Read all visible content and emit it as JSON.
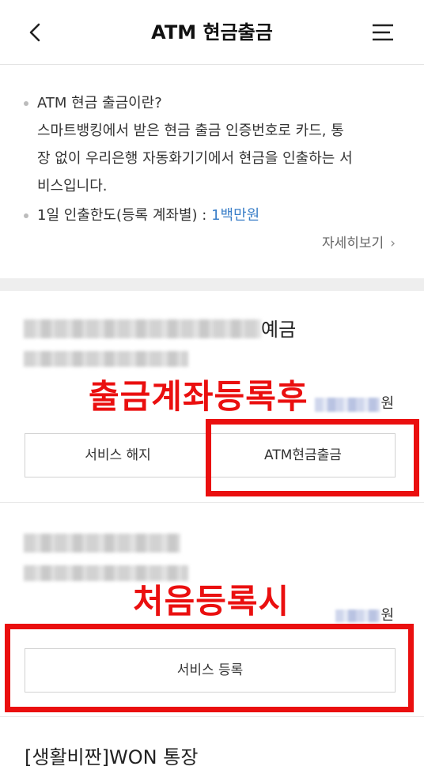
{
  "header": {
    "back_icon": "chevron-left-icon",
    "title": "ATM 현금출금",
    "menu_icon": "hamburger-menu-icon"
  },
  "info": {
    "line1": "ATM 현금 출금이란?",
    "line2": "스마트뱅킹에서 받은 현금 출금 인증번호로 카드, 통",
    "line3": "장 없이 우리은행 자동화기기에서 현금을 인출하는 서",
    "line4": "비스입니다.",
    "limit_label": "1일 인출한도(등록 계좌별) : ",
    "limit_value": "1백만원",
    "more_label": "자세히보기",
    "more_icon": "chevron-right-icon"
  },
  "accounts": [
    {
      "name_suffix": "예금",
      "won": "원",
      "buttons": {
        "cancel": "서비스 해지",
        "withdraw": "ATM현금출금"
      },
      "annotation": "출금계좌등록후"
    },
    {
      "won": "원",
      "buttons": {
        "register": "서비스 등록"
      },
      "annotation": "처음등록시"
    },
    {
      "name": "[생활비짠]WON 통장"
    }
  ],
  "colors": {
    "accent_blue": "#3b7fc8",
    "annotation_red": "#ea0f0f",
    "divider": "#eeeeee"
  }
}
